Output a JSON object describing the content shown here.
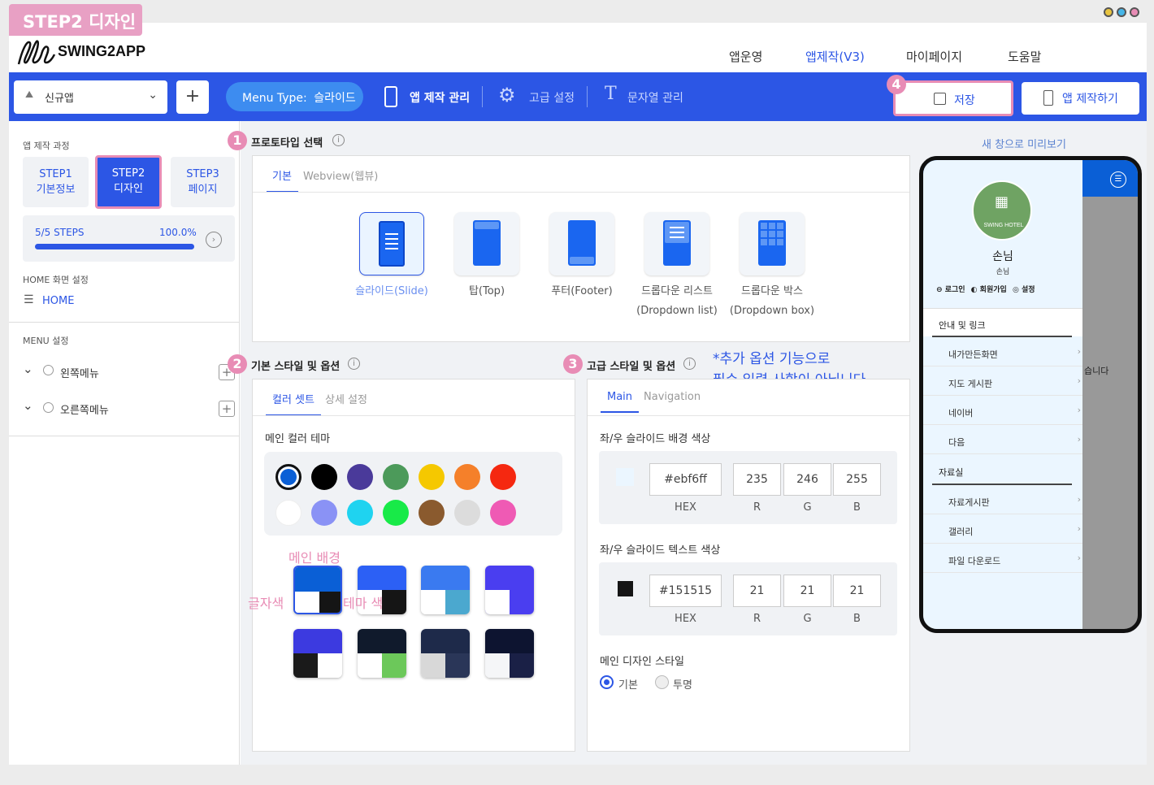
{
  "tag": "STEP2 디자인",
  "logo": "SWING2APP",
  "window_dots": [
    "#e8c440",
    "#46b6e8",
    "#e88cb5"
  ],
  "top_nav": [
    {
      "label": "앱운영"
    },
    {
      "label": "앱제작(V3)",
      "active": true
    },
    {
      "label": "마이페이지"
    },
    {
      "label": "도움말"
    }
  ],
  "toolbar": {
    "app_select": "신규앱",
    "add": "+",
    "menu_type_key": "Menu Type:",
    "menu_type_val": "슬라이드",
    "app_manage": "앱 제작 관리",
    "advanced": "고급 설정",
    "strings": "문자열 관리",
    "save": "저장",
    "build": "앱 제작하기"
  },
  "sidebar": {
    "process_title": "앱 제작 과정",
    "steps": [
      {
        "line1": "STEP1",
        "line2": "기본정보"
      },
      {
        "line1": "STEP2",
        "line2": "디자인",
        "active": true
      },
      {
        "line1": "STEP3",
        "line2": "페이지"
      }
    ],
    "progress_label": "5/5 STEPS",
    "progress_pct": "100.0%",
    "progress_fraction": 1.0,
    "home_title": "HOME 화면 설정",
    "home_item": "HOME",
    "menu_title": "MENU 설정",
    "menus": [
      "왼쪽메뉴",
      "오른쪽메뉴"
    ]
  },
  "prototype": {
    "title": "프로토타입 선택",
    "tabs": [
      "기본",
      "Webview(웹뷰)"
    ],
    "items": [
      {
        "l1": "슬라이드(Slide)",
        "l2": "",
        "selected": true
      },
      {
        "l1": "탑(Top)",
        "l2": ""
      },
      {
        "l1": "푸터(Footer)",
        "l2": ""
      },
      {
        "l1": "드롭다운 리스트",
        "l2": "(Dropdown list)"
      },
      {
        "l1": "드롭다운 박스",
        "l2": "(Dropdown box)"
      }
    ]
  },
  "basic_style": {
    "title": "기본 스타일 및 옵션",
    "tabs": [
      "컬러 셋트",
      "상세 설정"
    ],
    "theme_title": "메인 컬러 테마",
    "colors_row1": [
      "#0a5fd6",
      "#000000",
      "#4a3a9a",
      "#4c9a5a",
      "#f5c800",
      "#f5802a",
      "#f52810"
    ],
    "colors_row2": [
      "#ffffff",
      "#8a92f5",
      "#1fd3f0",
      "#18ea48",
      "#8a5a2e",
      "#dcdcdc",
      "#ef5ab4"
    ],
    "annot_main_bg": "메인 배경",
    "annot_text_color": "글자색",
    "annot_theme_color": "테마 색"
  },
  "adv_style": {
    "title": "고급 스타일 및 옵션",
    "note_line1": "*추가 옵션 기능으로",
    "note_line2": "필수 입력 사항이 아닙니다.",
    "tabs": [
      "Main",
      "Navigation"
    ],
    "bg_title": "좌/우 슬라이드 배경 색상",
    "bg": {
      "hex": "#ebf6ff",
      "r": "235",
      "g": "246",
      "b": "255"
    },
    "text_title": "좌/우 슬라이드 텍스트 색상",
    "text": {
      "hex": "#151515",
      "r": "21",
      "g": "21",
      "b": "21"
    },
    "labels": {
      "hex": "HEX",
      "r": "R",
      "g": "G",
      "b": "B"
    },
    "design_title": "메인 디자인 스타일",
    "radio": [
      "기본",
      "투명"
    ]
  },
  "preview": {
    "link": "새 창으로 미리보기",
    "hotel": "SWING HOTEL",
    "user": "손님",
    "user_sub": "손님",
    "actions": [
      "로그인",
      "회원가입",
      "설정"
    ],
    "sections": [
      {
        "title": "안내 및 링크",
        "items": [
          "내가만든화면",
          "지도 게시판",
          "네이버",
          "다음"
        ]
      },
      {
        "title": "자료실",
        "items": [
          "자료게시판",
          "갤러리",
          "파일 다운로드"
        ]
      }
    ],
    "behind_text": "습니다"
  },
  "badges": [
    "1",
    "2",
    "3",
    "4"
  ]
}
